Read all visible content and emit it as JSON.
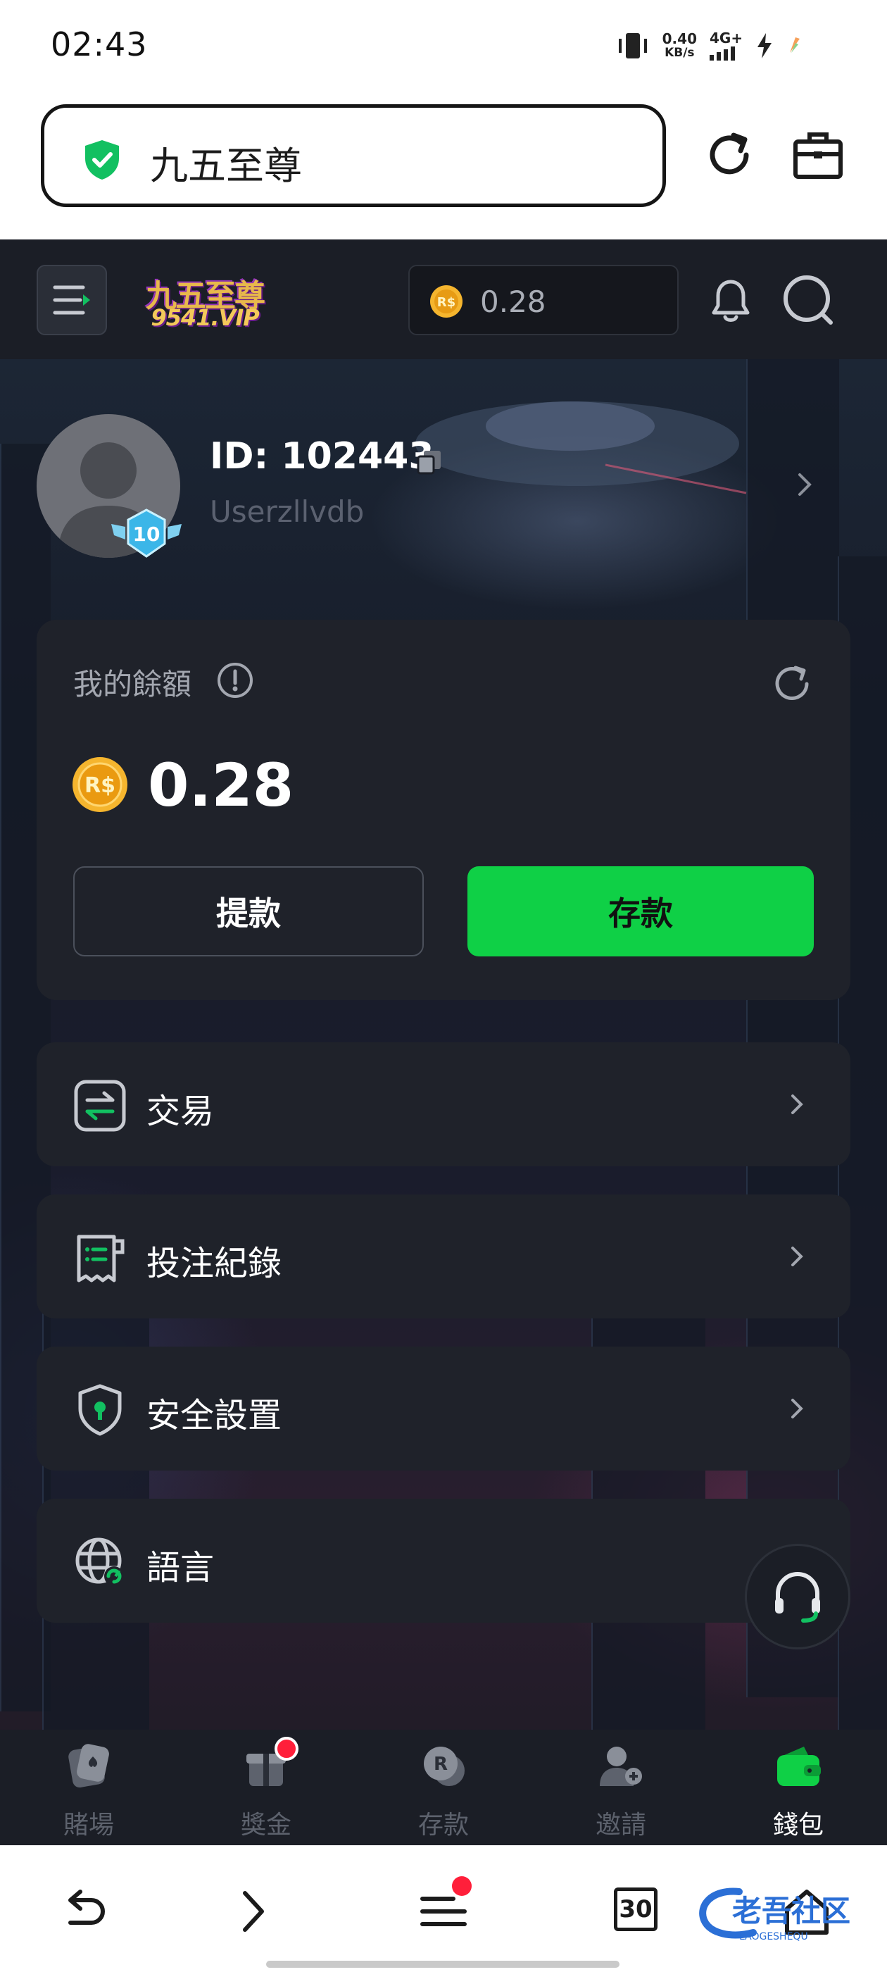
{
  "status_bar": {
    "time": "02:43",
    "net_speed_value": "0.40",
    "net_speed_unit": "KB/s",
    "network": "4G+"
  },
  "browser": {
    "url_title": "九五至尊",
    "open_tabs": "30",
    "watermark_text": "老吾社区",
    "watermark_sub": "LAOGESHEQU"
  },
  "header": {
    "logo_top": "九五至尊",
    "logo_bottom": "9541.VIP",
    "balance": "0.28",
    "currency_symbol": "R$"
  },
  "profile": {
    "id_label": "ID: 102443",
    "username": "Userzllvdb",
    "vip_level": "10"
  },
  "balance_card": {
    "title": "我的餘額",
    "value": "0.28",
    "currency_symbol": "R$",
    "withdraw_label": "提款",
    "deposit_label": "存款"
  },
  "menu": {
    "items": [
      {
        "label": "交易",
        "icon": "transaction-icon"
      },
      {
        "label": "投注紀錄",
        "icon": "receipt-icon"
      },
      {
        "label": "安全設置",
        "icon": "shield-lock-icon"
      },
      {
        "label": "語言",
        "icon": "globe-icon"
      }
    ]
  },
  "tabbar": {
    "items": [
      {
        "label": "賭場",
        "icon": "casino-icon"
      },
      {
        "label": "獎金",
        "icon": "gift-icon"
      },
      {
        "label": "存款",
        "icon": "deposit-coin-icon"
      },
      {
        "label": "邀請",
        "icon": "invite-user-icon"
      },
      {
        "label": "錢包",
        "icon": "wallet-icon"
      }
    ],
    "active": "錢包"
  },
  "colors": {
    "accent_green": "#0fd046",
    "app_bg": "#1b1e26",
    "card_bg": "#1f222a",
    "notification_red": "#ff1f3a",
    "gold": "#f5b52e"
  }
}
